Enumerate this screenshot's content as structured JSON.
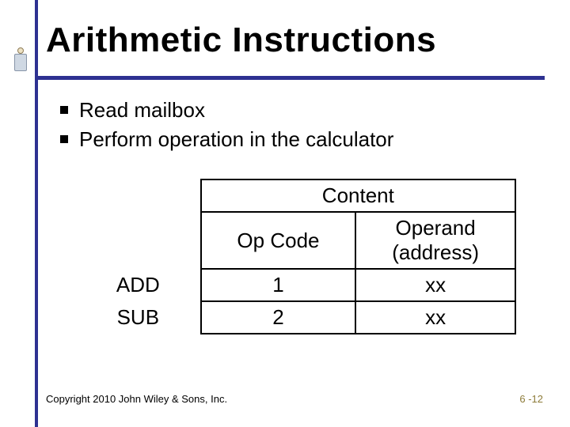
{
  "title": "Arithmetic Instructions",
  "bullets": [
    "Read mailbox",
    "Perform operation in the calculator"
  ],
  "table": {
    "group_header": "Content",
    "col1": "Op Code",
    "col2_line1": "Operand",
    "col2_line2": "(address)",
    "rows": [
      {
        "label": "ADD",
        "opcode": "1",
        "operand": "xx"
      },
      {
        "label": "SUB",
        "opcode": "2",
        "operand": "xx"
      }
    ]
  },
  "footer": {
    "copyright": "Copyright 2010 John Wiley & Sons, Inc.",
    "pagenum": "6 -12"
  },
  "chart_data": {
    "type": "table",
    "title": "Content",
    "columns": [
      "",
      "Op Code",
      "Operand (address)"
    ],
    "rows": [
      [
        "ADD",
        "1",
        "xx"
      ],
      [
        "SUB",
        "2",
        "xx"
      ]
    ]
  }
}
